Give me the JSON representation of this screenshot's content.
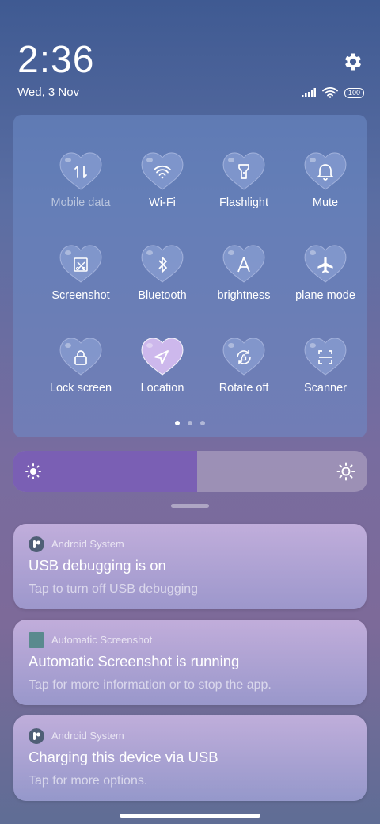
{
  "header": {
    "time": "2:36",
    "date": "Wed, 3 Nov",
    "battery": "100"
  },
  "quick_settings": {
    "tiles": [
      {
        "label": "Mobile data",
        "icon": "mobile-data-icon",
        "state": "off"
      },
      {
        "label": "Wi-Fi",
        "icon": "wifi-icon",
        "state": "off"
      },
      {
        "label": "Flashlight",
        "icon": "flashlight-icon",
        "state": "off"
      },
      {
        "label": "Mute",
        "icon": "bell-icon",
        "state": "off"
      },
      {
        "label": "Screenshot",
        "icon": "screenshot-icon",
        "state": "off"
      },
      {
        "label": "Bluetooth",
        "icon": "bluetooth-icon",
        "state": "off"
      },
      {
        "label": "brightness",
        "icon": "auto-brightness-icon",
        "state": "off"
      },
      {
        "label": "plane mode",
        "icon": "airplane-icon",
        "state": "off"
      },
      {
        "label": "Lock screen",
        "icon": "lock-icon",
        "state": "off"
      },
      {
        "label": "Location",
        "icon": "location-icon",
        "state": "on"
      },
      {
        "label": "Rotate off",
        "icon": "rotate-lock-icon",
        "state": "off"
      },
      {
        "label": "Scanner",
        "icon": "scanner-icon",
        "state": "off"
      }
    ],
    "page_count": 3,
    "current_page": 1
  },
  "brightness": {
    "level": 0.52
  },
  "notifications": [
    {
      "app": "Android System",
      "title": "USB debugging is on",
      "body": "Tap to turn off USB debugging"
    },
    {
      "app": "Automatic Screenshot",
      "title": "Automatic Screenshot is running",
      "body": "Tap for more information or to stop the app."
    },
    {
      "app": "Android System",
      "title": "Charging this device via USB",
      "body": "Tap for more options."
    }
  ],
  "colors": {
    "accent": "#7a5fb4",
    "active_tile": "#cdb8ec"
  }
}
